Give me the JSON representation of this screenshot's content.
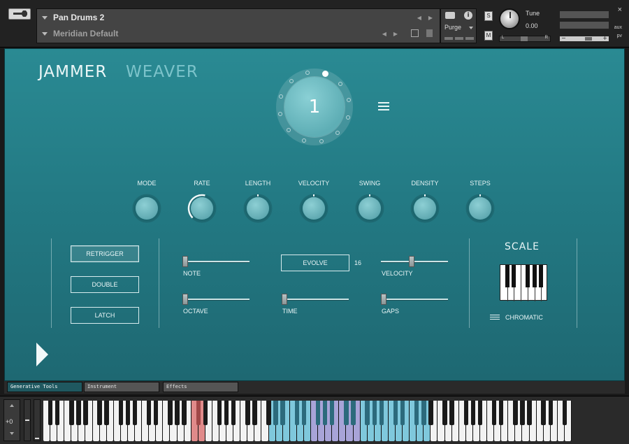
{
  "header": {
    "instrument_name": "Pan Drums 2",
    "snapshot_name": "Meridian Default",
    "purge_label": "Purge",
    "solo_label": "S",
    "mute_label": "M",
    "tune_label": "Tune",
    "tune_value": "0.00",
    "pan_left": "L",
    "pan_right": "R",
    "vol_minus": "−",
    "vol_plus": "+",
    "close_label": "×",
    "aux_label": "aux",
    "pv_label": "pv",
    "info_label": "i"
  },
  "main": {
    "title_left": "JAMMER",
    "title_right": "WEAVER",
    "pattern": {
      "value": "1",
      "slots": 12,
      "active_slot": 1
    },
    "knobs": [
      {
        "label": "MODE",
        "value": 0.0
      },
      {
        "label": "RATE",
        "value": 0.55
      },
      {
        "label": "LENGTH",
        "value": 0.5
      },
      {
        "label": "VELOCITY",
        "value": 0.5
      },
      {
        "label": "SWING",
        "value": 0.5
      },
      {
        "label": "DENSITY",
        "value": 0.5
      },
      {
        "label": "STEPS",
        "value": 0.5
      }
    ],
    "toggles": [
      {
        "label": "RETRIGGER",
        "active": true
      },
      {
        "label": "DOUBLE",
        "active": false
      },
      {
        "label": "LATCH",
        "active": false
      }
    ],
    "sliders": {
      "note": {
        "label": "NOTE",
        "value": 0.0
      },
      "octave": {
        "label": "OCTAVE",
        "value": 0.0
      },
      "time": {
        "label": "TIME",
        "value": 0.0
      },
      "velocity": {
        "label": "VELOCITY",
        "value": 0.45
      },
      "gaps": {
        "label": "GAPS",
        "value": 0.0
      }
    },
    "evolve_label": "EVOLVE",
    "evolve_value": "16",
    "scale": {
      "title": "SCALE",
      "mode": "CHROMATIC"
    }
  },
  "tabs": [
    {
      "label": "Generative Tools",
      "active": true
    },
    {
      "label": "Instrument",
      "active": false
    },
    {
      "label": "Effects",
      "active": false
    }
  ],
  "keyboard": {
    "octave_value": "+0",
    "colors": {
      "red_zone": "#e08a8a",
      "blue_zone": "#7fc8dc",
      "purple_zone": "#a8a4d8"
    }
  },
  "colors": {
    "panel_top": "#2a8a93",
    "panel_bottom": "#1e6872",
    "accent_light": "#eaf6f7"
  }
}
